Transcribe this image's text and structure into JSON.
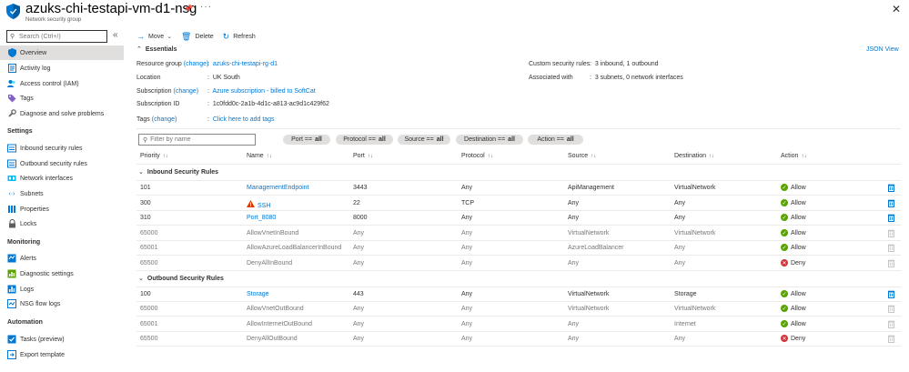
{
  "header": {
    "title": "azuks-chi-testapi-vm-d1-nsg",
    "subtitle": "Network security group",
    "pin_icon": "pin-icon",
    "more_icon": "more-icon",
    "close_icon": "close-icon"
  },
  "sidebar": {
    "search_placeholder": "Search (Ctrl+/)",
    "collapse_icon": "double-chevron-left-icon",
    "items": [
      {
        "label": "Overview",
        "icon": "shield-icon"
      },
      {
        "label": "Activity log",
        "icon": "log-icon"
      },
      {
        "label": "Access control (IAM)",
        "icon": "people-icon"
      },
      {
        "label": "Tags",
        "icon": "tag-icon"
      },
      {
        "label": "Diagnose and solve problems",
        "icon": "wrench-icon"
      }
    ],
    "sections": [
      {
        "title": "Settings",
        "items": [
          {
            "label": "Inbound security rules",
            "icon": "inbound-icon"
          },
          {
            "label": "Outbound security rules",
            "icon": "outbound-icon"
          },
          {
            "label": "Network interfaces",
            "icon": "network-interface-icon"
          },
          {
            "label": "Subnets",
            "icon": "subnet-icon"
          },
          {
            "label": "Properties",
            "icon": "properties-icon"
          },
          {
            "label": "Locks",
            "icon": "lock-icon"
          }
        ]
      },
      {
        "title": "Monitoring",
        "items": [
          {
            "label": "Alerts",
            "icon": "alert-icon"
          },
          {
            "label": "Diagnostic settings",
            "icon": "diagnostic-icon"
          },
          {
            "label": "Logs",
            "icon": "logs-icon"
          },
          {
            "label": "NSG flow logs",
            "icon": "flow-log-icon"
          }
        ]
      },
      {
        "title": "Automation",
        "items": [
          {
            "label": "Tasks (preview)",
            "icon": "tasks-icon"
          },
          {
            "label": "Export template",
            "icon": "export-icon"
          }
        ]
      }
    ]
  },
  "toolbar": {
    "move_label": "Move",
    "delete_label": "Delete",
    "refresh_label": "Refresh"
  },
  "essentials": {
    "title": "Essentials",
    "json_view": "JSON View",
    "change_label": "(change)",
    "left": {
      "resource_group_label": "Resource group",
      "resource_group_value": "azuks-chi-testapi-rg-d1",
      "location_label": "Location",
      "location_value": "UK South",
      "subscription_label": "Subscription",
      "subscription_value": "Azure subscription - billed to SoftCat",
      "subscription_id_label": "Subscription ID",
      "subscription_id_value": "1c0fdd0c-2a1b-4d1c-a813-ac9d1c429f62",
      "tags_label": "Tags",
      "tags_value": "Click here to add tags"
    },
    "right": {
      "custom_rules_label": "Custom security rules",
      "custom_rules_value": "3 inbound, 1 outbound",
      "associated_label": "Associated with",
      "associated_value": "3 subnets, 0 network interfaces"
    }
  },
  "filters": {
    "search_placeholder": "Filter by name",
    "pills": [
      {
        "label": "Port ==",
        "value": "all"
      },
      {
        "label": "Protocol ==",
        "value": "all"
      },
      {
        "label": "Source ==",
        "value": "all"
      },
      {
        "label": "Destination ==",
        "value": "all"
      },
      {
        "label": "Action ==",
        "value": "all"
      }
    ]
  },
  "table": {
    "columns": [
      "Priority",
      "Name",
      "Port",
      "Protocol",
      "Source",
      "Destination",
      "Action"
    ],
    "sort_glyph": "↑↓",
    "inbound": {
      "title": "Inbound Security Rules",
      "rows": [
        {
          "priority": "101",
          "name": "ManagementEndpoint",
          "port": "3443",
          "protocol": "Any",
          "source": "ApiManagement",
          "destination": "VirtualNetwork",
          "action": "Allow"
        },
        {
          "priority": "300",
          "name": "SSH",
          "port": "22",
          "protocol": "TCP",
          "source": "Any",
          "destination": "Any",
          "action": "Allow",
          "warning": true
        },
        {
          "priority": "310",
          "name": "Port_8080",
          "port": "8000",
          "protocol": "Any",
          "source": "Any",
          "destination": "Any",
          "action": "Allow"
        },
        {
          "priority": "65000",
          "name": "AllowVnetInBound",
          "port": "Any",
          "protocol": "Any",
          "source": "VirtualNetwork",
          "destination": "VirtualNetwork",
          "action": "Allow",
          "default": true
        },
        {
          "priority": "65001",
          "name": "AllowAzureLoadBalancerInBound",
          "port": "Any",
          "protocol": "Any",
          "source": "AzureLoadBalancer",
          "destination": "Any",
          "action": "Allow",
          "default": true
        },
        {
          "priority": "65500",
          "name": "DenyAllInBound",
          "port": "Any",
          "protocol": "Any",
          "source": "Any",
          "destination": "Any",
          "action": "Deny",
          "default": true
        }
      ]
    },
    "outbound": {
      "title": "Outbound Security Rules",
      "rows": [
        {
          "priority": "100",
          "name": "Storage",
          "port": "443",
          "protocol": "Any",
          "source": "VirtualNetwork",
          "destination": "Storage",
          "action": "Allow"
        },
        {
          "priority": "65000",
          "name": "AllowVnetOutBound",
          "port": "Any",
          "protocol": "Any",
          "source": "VirtualNetwork",
          "destination": "VirtualNetwork",
          "action": "Allow",
          "default": true
        },
        {
          "priority": "65001",
          "name": "AllowInternetOutBound",
          "port": "Any",
          "protocol": "Any",
          "source": "Any",
          "destination": "Internet",
          "action": "Allow",
          "default": true
        },
        {
          "priority": "65500",
          "name": "DenyAllOutBound",
          "port": "Any",
          "protocol": "Any",
          "source": "Any",
          "destination": "Any",
          "action": "Deny",
          "default": true
        }
      ]
    }
  },
  "colors": {
    "accent": "#0078d4",
    "allow": "#57a300",
    "deny": "#d13438",
    "warning": "#d83b01",
    "active_nav": "#e1dfdd"
  }
}
